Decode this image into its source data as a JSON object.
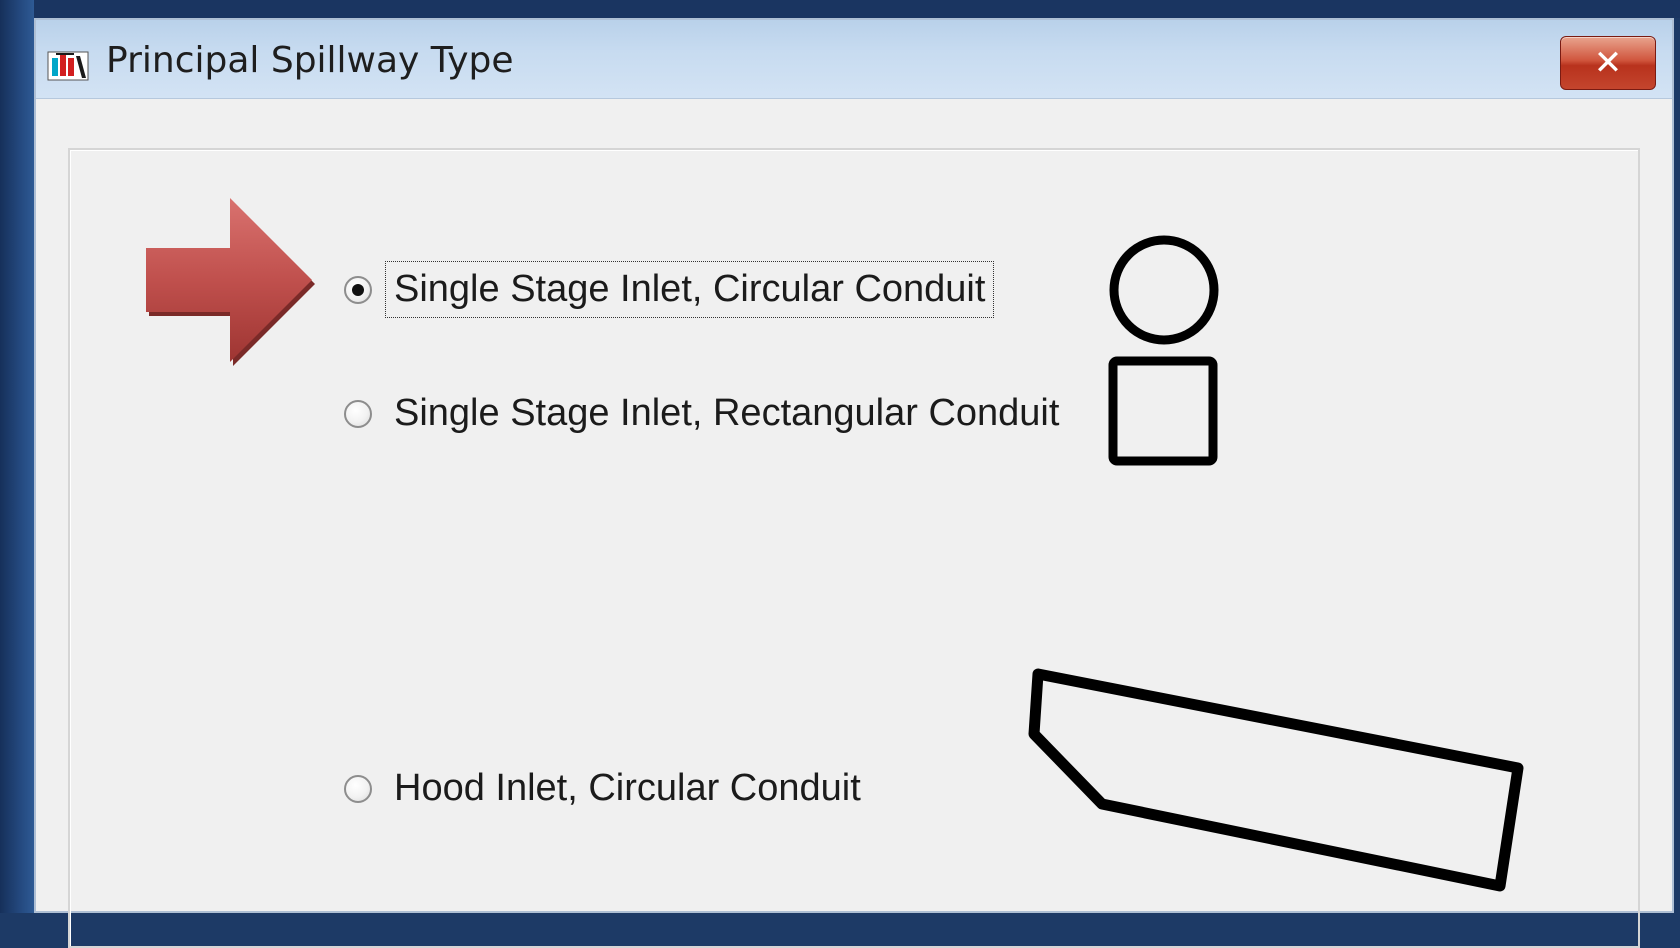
{
  "window": {
    "title": "Principal Spillway Type",
    "close_label": "✕"
  },
  "options": [
    {
      "label": "Single Stage Inlet, Circular Conduit",
      "selected": true
    },
    {
      "label": "Single Stage Inlet, Rectangular Conduit",
      "selected": false
    },
    {
      "label": "Hood Inlet, Circular Conduit",
      "selected": false
    }
  ],
  "annotation": {
    "arrow_color": "#c0504d"
  }
}
